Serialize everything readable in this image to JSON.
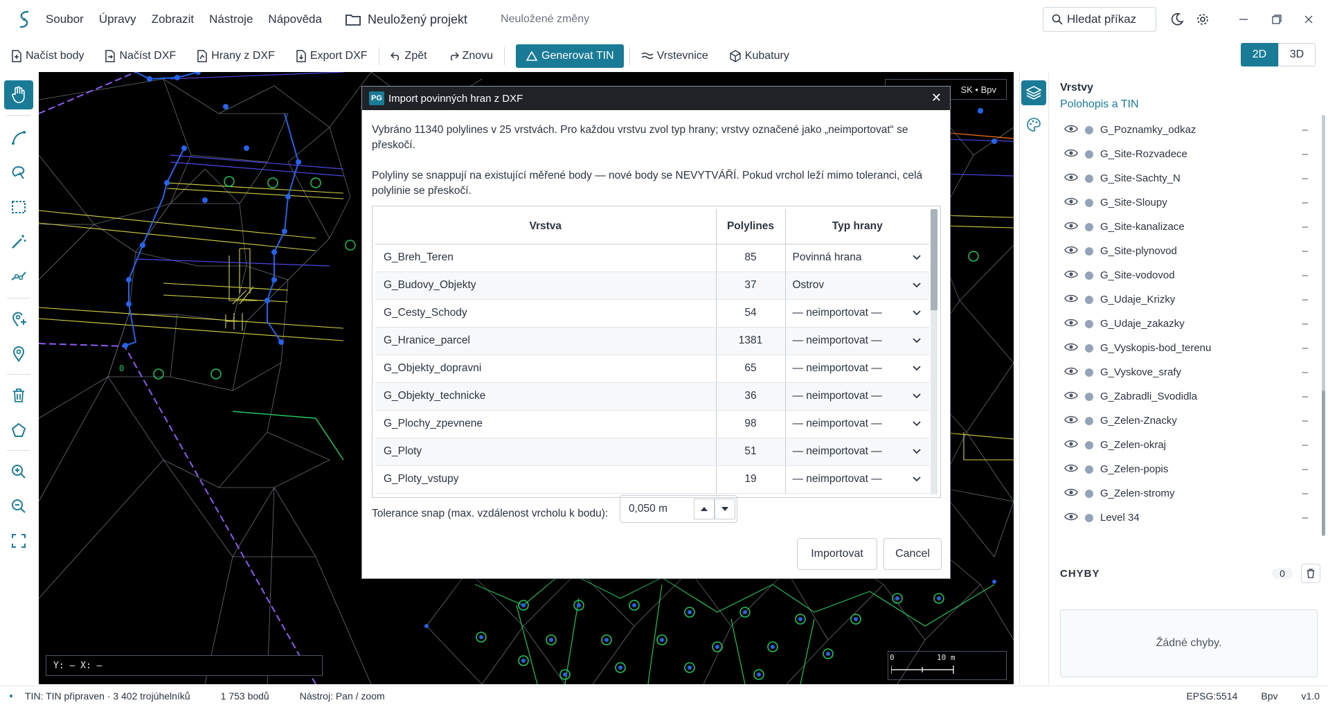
{
  "menubar": {
    "items": [
      "Soubor",
      "Úpravy",
      "Zobrazit",
      "Nástroje",
      "Nápověda"
    ],
    "project": "Neuložený projekt",
    "unsaved": "Neuložené změny",
    "search": "Hledat příkaz"
  },
  "toolbar": {
    "load_points": "Načíst body",
    "load_dxf": "Načíst DXF",
    "edges_dxf": "Hrany z DXF",
    "export_dxf": "Export DXF",
    "undo": "Zpět",
    "redo": "Znovu",
    "generate_tin": "Generovat TIN",
    "contours": "Vrstevnice",
    "volumes": "Kubatury",
    "view_2d": "2D",
    "view_3d": "3D"
  },
  "canvas": {
    "coords": "Y: —   X: —",
    "crs": "SK • Bpv",
    "scale_start": "0",
    "scale_end": "10 m",
    "marker": "0"
  },
  "dialog": {
    "icon": "PG",
    "title": "Import povinných hran z DXF",
    "para1": "Vybráno 11340 polylines v 25 vrstvách. Pro každou vrstvu zvol typ hrany; vrstvy označené jako „neimportovat“ se přeskočí.",
    "para2": "Polyliny se snappují na existující měřené body — nové body se NEVYTVÁŘÍ. Pokud vrchol leží mimo toleranci, celá polylinie se přeskočí.",
    "columns": {
      "layer": "Vrstva",
      "polylines": "Polylines",
      "edge_type": "Typ hrany"
    },
    "rows": [
      {
        "layer": "G_Breh_Teren",
        "count": "85",
        "type": "Povinná hrana"
      },
      {
        "layer": "G_Budovy_Objekty",
        "count": "37",
        "type": "Ostrov"
      },
      {
        "layer": "G_Cesty_Schody",
        "count": "54",
        "type": "— neimportovat —"
      },
      {
        "layer": "G_Hranice_parcel",
        "count": "1381",
        "type": "— neimportovat —"
      },
      {
        "layer": "G_Objekty_dopravni",
        "count": "65",
        "type": "— neimportovat —"
      },
      {
        "layer": "G_Objekty_technicke",
        "count": "36",
        "type": "— neimportovat —"
      },
      {
        "layer": "G_Plochy_zpevnene",
        "count": "98",
        "type": "— neimportovat —"
      },
      {
        "layer": "G_Ploty",
        "count": "51",
        "type": "— neimportovat —"
      },
      {
        "layer": "G_Ploty_vstupy",
        "count": "19",
        "type": "— neimportovat —"
      }
    ],
    "tolerance_label": "Tolerance snap (max. vzdálenost vrcholu k bodu):",
    "tolerance_value": "0,050 m",
    "import_button": "Importovat",
    "cancel_button": "Cancel"
  },
  "rpanel": {
    "title": "Vrstvy",
    "subtitle": "Polohopis a TIN",
    "layers": [
      "G_Poznamky_odkaz",
      "G_Site-Rozvadece",
      "G_Site-Sachty_N",
      "G_Site-Sloupy",
      "G_Site-kanalizace",
      "G_Site-plynovod",
      "G_Site-vodovod",
      "G_Udaje_Krizky",
      "G_Udaje_zakazky",
      "G_Vyskopis-bod_terenu",
      "G_Vyskove_srafy",
      "G_Zabradli_Svodidla",
      "G_Zelen-Znacky",
      "G_Zelen-okraj",
      "G_Zelen-popis",
      "G_Zelen-stromy",
      "Level 34"
    ],
    "layer_dash": "–",
    "errors_title": "CHYBY",
    "errors_count": "0",
    "errors_empty": "Žádné chyby."
  },
  "statusbar": {
    "tin": "TIN: TIN připraven · 3 402 trojúhelníků",
    "points": "1 753  bodů",
    "tool": "Nástroj: Pan / zoom",
    "epsg": "EPSG:5514",
    "vertical": "Bpv",
    "version": "v1.0"
  },
  "colors": {
    "accent": "#1a7b96",
    "canvas": "#000000",
    "tin_edges": "#9ca3af",
    "points": "#2563eb",
    "green": "#22c55e",
    "yellow": "#d4d44a",
    "purple": "#7c3aed"
  }
}
